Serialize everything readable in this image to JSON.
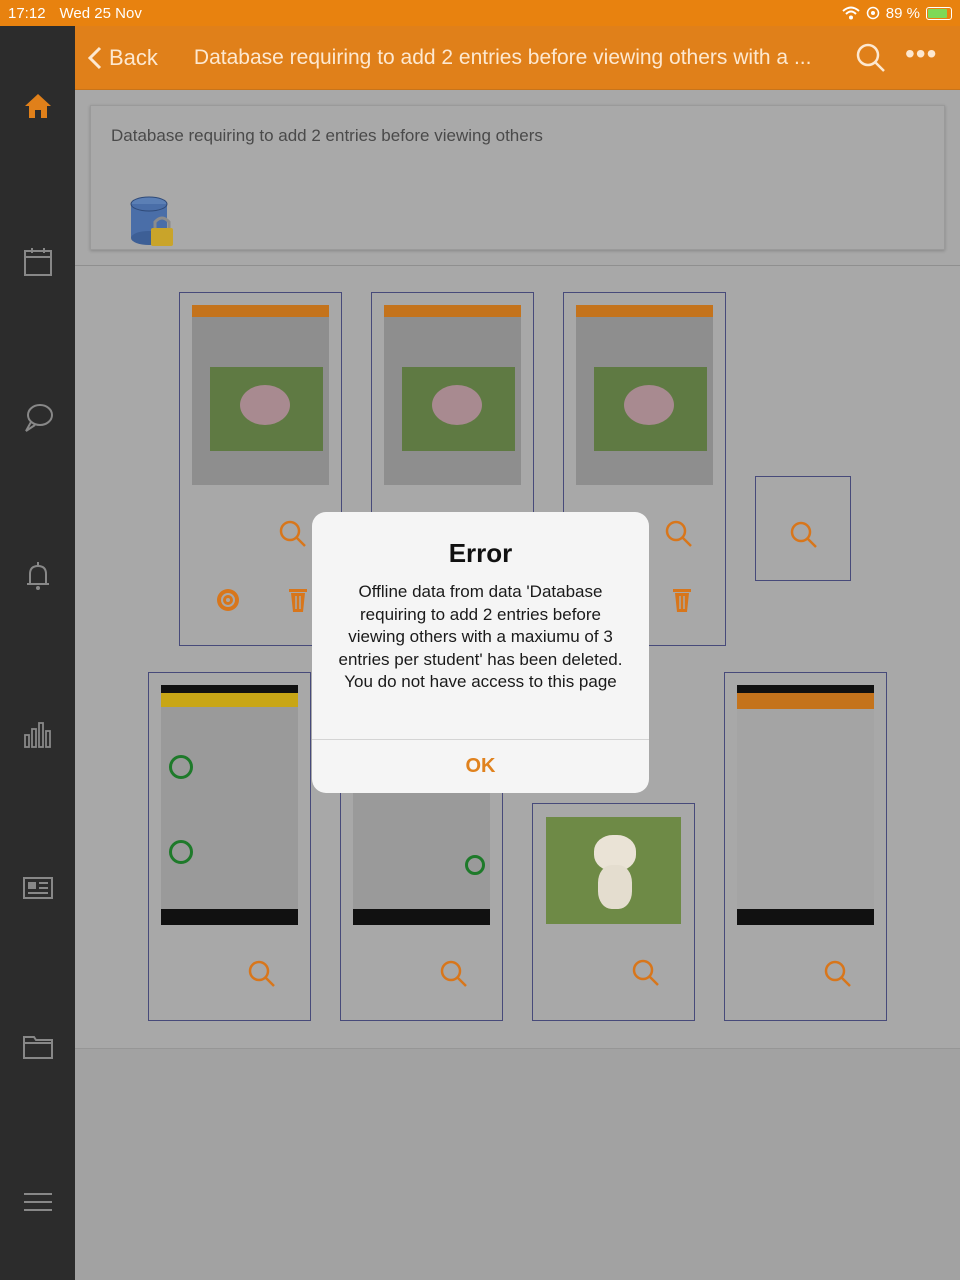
{
  "status_bar": {
    "time": "17:12",
    "date": "Wed 25 Nov",
    "battery": "89 %",
    "icons": [
      "wifi-icon",
      "location-icon",
      "battery-charging-icon"
    ]
  },
  "sidebar": {
    "items": [
      "home-icon",
      "calendar-icon",
      "chat-icon",
      "bell-icon",
      "bar-chart-icon",
      "newspaper-icon",
      "folder-icon",
      "menu-icon"
    ]
  },
  "header": {
    "back_label": "Back",
    "title": "Database requiring to add 2 entries before viewing others with a ..."
  },
  "intro": {
    "title": "Database requiring to add 2 entries before viewing others"
  },
  "modal": {
    "title": "Error",
    "message": "Offline data from data 'Database requiring to add 2 entries before viewing others with a maxiumu of 3 entries per student' has been deleted. You do not have access to this page",
    "ok_label": "OK"
  },
  "colors": {
    "accent": "#e0801a",
    "sidebar": "#2c2c2c",
    "entry_border": "#474a7a"
  }
}
